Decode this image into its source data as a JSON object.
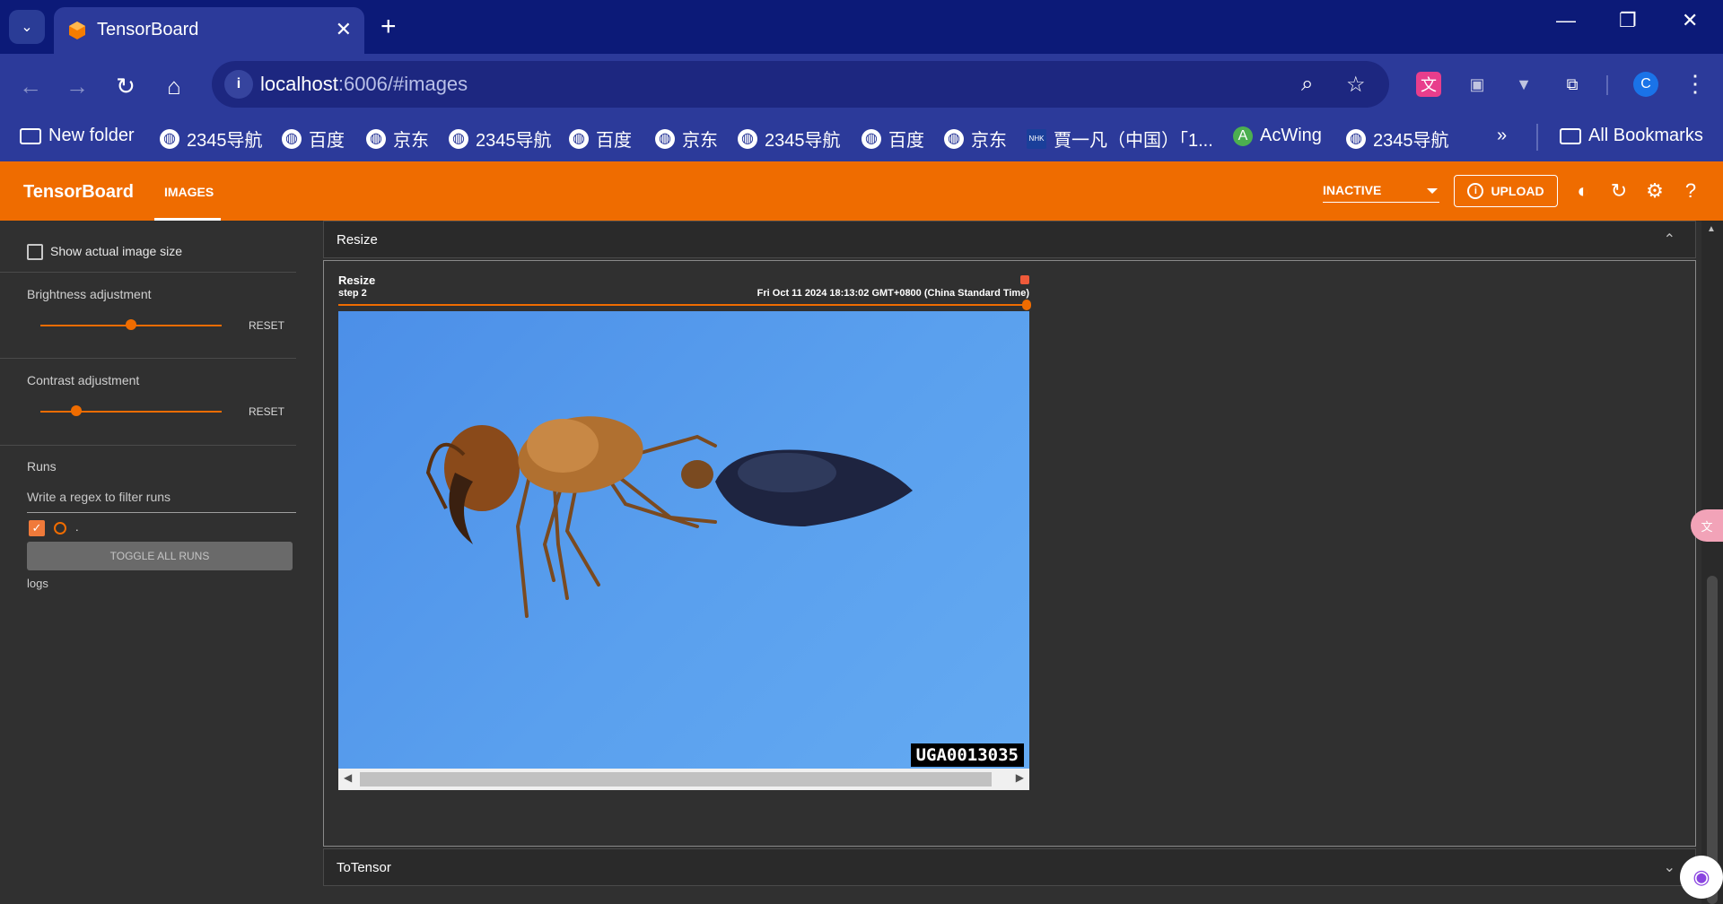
{
  "browser": {
    "tab_title": "TensorBoard",
    "url_host": "localhost",
    "url_rest": ":6006/#images",
    "profile_initial": "C",
    "bookmarks": [
      "New folder",
      "2345导航",
      "百度",
      "京东",
      "2345导航",
      "百度",
      "京东",
      "2345导航",
      "百度",
      "京东",
      "賈一凡（中国）「1...",
      "AcWing",
      "2345导航"
    ],
    "bookmarks_overflow": "»",
    "all_bookmarks": "All Bookmarks"
  },
  "header": {
    "brand": "TensorBoard",
    "active_tab": "IMAGES",
    "status_select": "INACTIVE",
    "upload_label": "UPLOAD"
  },
  "sidebar": {
    "show_actual_size": "Show actual image size",
    "brightness": {
      "label": "Brightness adjustment",
      "value": 0.5,
      "reset": "RESET"
    },
    "contrast": {
      "label": "Contrast adjustment",
      "value": 0.2,
      "reset": "RESET"
    },
    "runs_label": "Runs",
    "filter_placeholder": "Write a regex to filter runs",
    "run_name": ".",
    "toggle_all": "TOGGLE ALL RUNS",
    "logs": "logs"
  },
  "main": {
    "section_resize": "Resize",
    "section_totensor": "ToTensor",
    "image_card": {
      "title": "Resize",
      "step": "step 2",
      "timestamp": "Fri Oct 11 2024 18:13:02 GMT+0800 (China Standard Time)",
      "watermark": "UGA0013035"
    }
  },
  "colors": {
    "accent": "#ef6c00",
    "browser_frame": "#2c3a9a",
    "background": "#303030"
  }
}
